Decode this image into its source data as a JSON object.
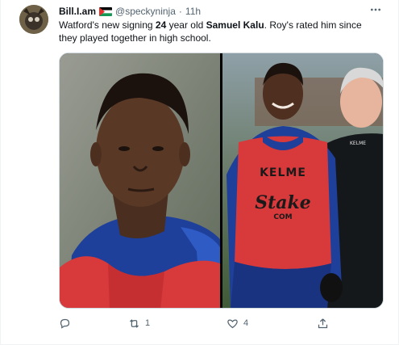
{
  "tweet": {
    "display_name": "Bill.I.am",
    "handle": "@speckyninja",
    "separator": "·",
    "time": "11h",
    "text_parts": [
      "Watford's new signing ",
      "24",
      " year old ",
      "Samuel Kalu",
      ". Roy's rated him since they played together in high school."
    ]
  },
  "media": {
    "right_bib_text_1": "KELME",
    "right_bib_text_2": "Stake",
    "right_bib_text_3": "COM",
    "right_jacket_text": "KELME"
  },
  "actions": {
    "reply_count": "",
    "retweet_count": "1",
    "like_count": "4",
    "share_count": ""
  },
  "icons": {
    "more": "more-icon",
    "reply": "reply-icon",
    "retweet": "retweet-icon",
    "like": "like-icon",
    "share": "share-icon"
  },
  "colors": {
    "text": "#0f1419",
    "muted": "#536471",
    "border": "#cfd9de",
    "bib_red": "#d8393b",
    "jacket_blue": "#1e3f9a"
  }
}
